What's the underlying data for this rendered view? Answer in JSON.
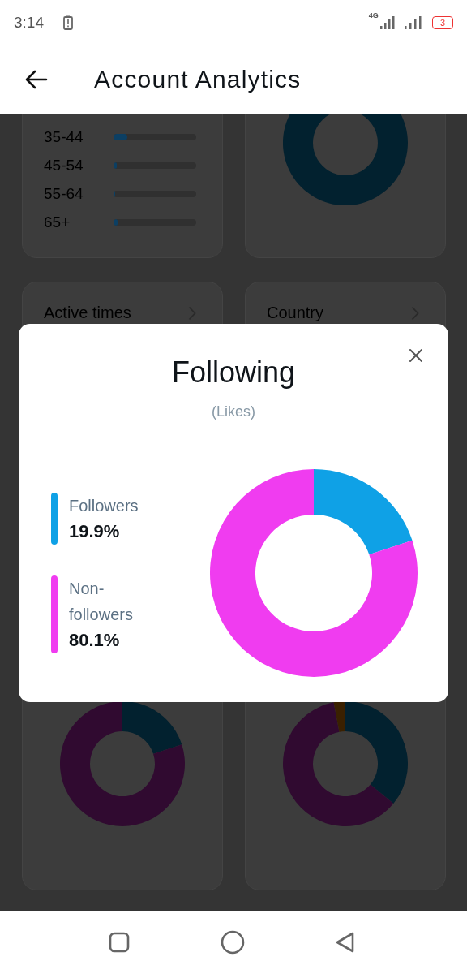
{
  "status_bar": {
    "time": "3:14",
    "network": "4G",
    "battery": "3"
  },
  "header": {
    "title": "Account Analytics"
  },
  "age_rows": [
    {
      "label": "35-44",
      "level": 0.17
    },
    {
      "label": "45-54",
      "level": 0.04
    },
    {
      "label": "55-64",
      "level": 0.02
    },
    {
      "label": "65+",
      "level": 0.05
    }
  ],
  "cards": [
    {
      "title": "Active times"
    },
    {
      "title": "Country"
    }
  ],
  "dialog": {
    "title": "Following",
    "subtitle": "(Likes)",
    "legend": [
      {
        "value": "19.9%",
        "color": "#0fa1e6"
      },
      {
        "value": "80.1%",
        "color": "#f03cf0"
      }
    ],
    "chart_data": {
      "type": "donut",
      "categories": [
        "Followers",
        "Non-followers"
      ],
      "values": [
        19.9,
        80.1
      ]
    }
  }
}
